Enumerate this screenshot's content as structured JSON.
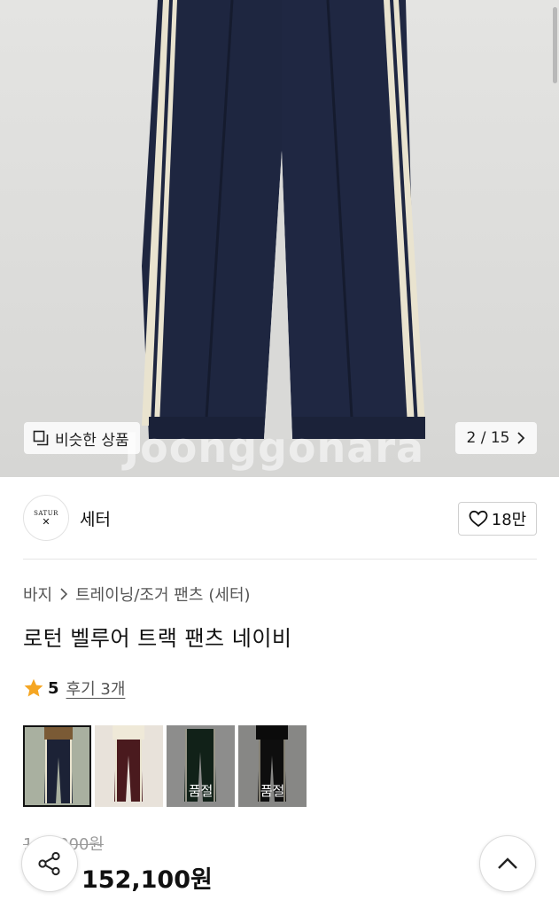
{
  "hero": {
    "watermark": "Joonggonara",
    "similar_label": "비슷한 상품",
    "pager_label": "2 / 15"
  },
  "shop": {
    "logo_text": "SATUR",
    "name": "세터",
    "like_count": "18만"
  },
  "product": {
    "breadcrumb_cat1": "바지",
    "breadcrumb_cat2": "트레이닝/조거 팬츠",
    "breadcrumb_brand": "(세터)",
    "title": "로턴 벨루어 트랙 팬츠 네이비",
    "rating_score": "5",
    "review_link": "후기 3개"
  },
  "options": [
    {
      "color": "#1c2236",
      "soldout": "",
      "selected": true
    },
    {
      "color": "#4a1a1e",
      "soldout": "",
      "selected": false
    },
    {
      "color": "#1b3326",
      "soldout": "품절",
      "selected": false
    },
    {
      "color": "#161616",
      "soldout": "품절",
      "selected": false
    }
  ],
  "price": {
    "original": "169,000원",
    "current": "152,100원",
    "accent": "#e8331e"
  },
  "colors": {
    "pants": "#1e2640",
    "stripe": "#e9e3cf",
    "star": "#f5a623"
  }
}
